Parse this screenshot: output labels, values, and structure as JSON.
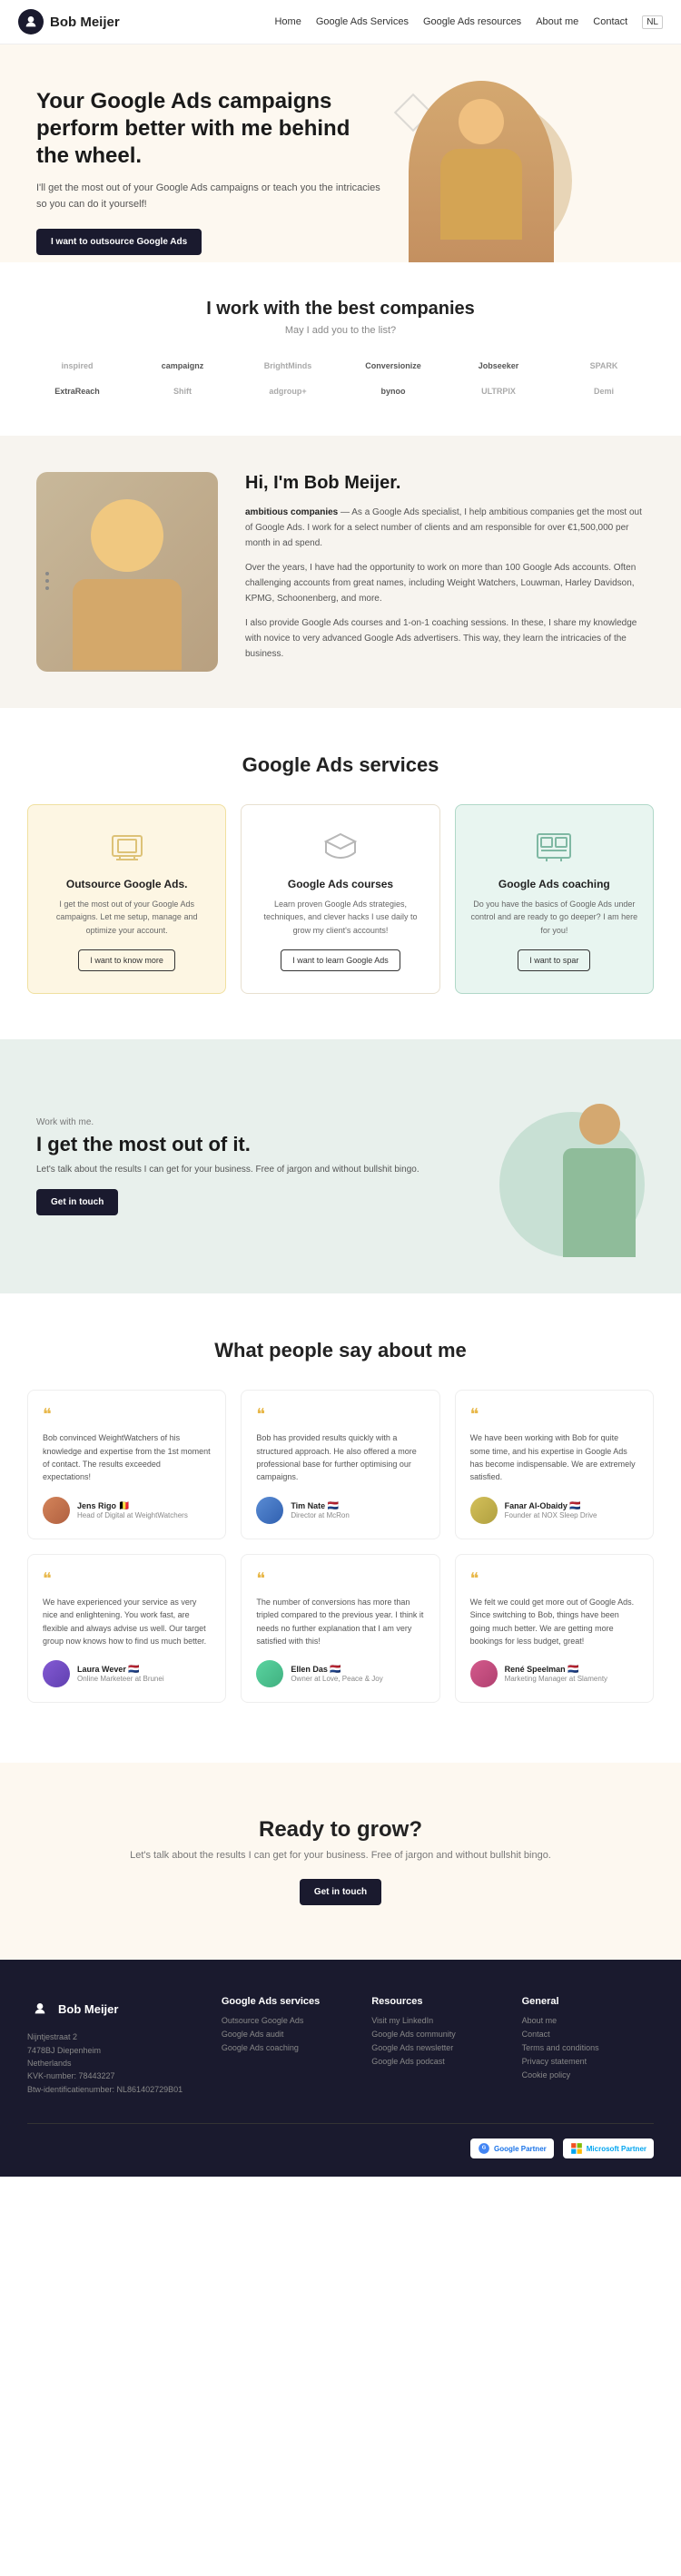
{
  "nav": {
    "brand": "Bob Meijer",
    "links": [
      "Home",
      "Google Ads Services",
      "Google Ads resources",
      "About me",
      "Contact",
      "NL"
    ]
  },
  "hero": {
    "headline": "Your Google Ads campaigns perform better with me behind the wheel.",
    "subtext": "I'll get the most out of your Google Ads campaigns or teach you the intricacies so you can do it yourself!",
    "cta": "I want to outsource Google Ads"
  },
  "companies": {
    "heading": "I work with the best companies",
    "subtext": "May I add you to the list?",
    "logos": [
      "inspired",
      "campaignz",
      "BrightMinds",
      "Conversionize",
      "Jobseeker",
      "SPARK",
      "ExtraReach",
      "Shift",
      "adgroup+",
      "bynoo",
      "ULTRPIX",
      "Demi"
    ]
  },
  "about": {
    "heading": "Hi, I'm Bob Meijer.",
    "paragraphs": [
      "As a Google Ads specialist, I help ambitious companies get the most out of Google Ads. I work for a select number of clients and am responsible for over €1,500,000 per month in ad spend.",
      "Over the years, I have had the opportunity to work on more than 100 Google Ads accounts. Often challenging accounts from great names, including Weight Watchers, Louwman, Harley Davidson, KPMG, Schoonenberg, and more.",
      "I also provide Google Ads courses and 1-on-1 coaching sessions. In these, I share my knowledge with novice to very advanced Google Ads advertisers. This way, they learn the intricacies of the business."
    ]
  },
  "services": {
    "heading": "Google Ads services",
    "cards": [
      {
        "title": "Outsource Google Ads.",
        "description": "I get the most out of your Google Ads campaigns. Let me setup, manage and optimize your account.",
        "cta": "I want to know more",
        "style": "yellow"
      },
      {
        "title": "Google Ads courses",
        "description": "Learn proven Google Ads strategies, techniques, and clever hacks I use daily to grow my client's accounts!",
        "cta": "I want to learn Google Ads",
        "style": "plain"
      },
      {
        "title": "Google Ads coaching",
        "description": "Do you have the basics of Google Ads under control and are ready to go deeper? I am here for you!",
        "cta": "I want to spar",
        "style": "teal"
      }
    ]
  },
  "cta_banner": {
    "label": "Work with me.",
    "heading": "I get the most out of it.",
    "subtext": "Let's talk about the results I can get for your business. Free of jargon and without bullshit bingo.",
    "cta": "Get in touch"
  },
  "testimonials": {
    "heading": "What people say about me",
    "items": [
      {
        "text": "Bob convinced WeightWatchers of his knowledge and expertise from the 1st moment of contact. The results exceeded expectations!",
        "name": "Jens Rigo",
        "flag": "🇧🇪",
        "title": "Head of Digital at WeightWatchers",
        "avatar": "av1"
      },
      {
        "text": "Bob has provided results quickly with a structured approach. He also offered a more professional base for further optimising our campaigns.",
        "name": "Tim Nate",
        "flag": "🇳🇱",
        "title": "Director at McRon",
        "avatar": "av2"
      },
      {
        "text": "We have been working with Bob for quite some time, and his expertise in Google Ads has become indispensable. We are extremely satisfied.",
        "name": "Fanar Al-Obaidy",
        "flag": "🇳🇱",
        "title": "Founder at NOX Sleep Drive",
        "avatar": "av3"
      },
      {
        "text": "We have experienced your service as very nice and enlightening. You work fast, are flexible and always advise us well. Our target group now knows how to find us much better.",
        "name": "Laura Wever",
        "flag": "🇳🇱",
        "title": "Online Marketeer at Brunei",
        "avatar": "av4"
      },
      {
        "text": "The number of conversions has more than tripled compared to the previous year. I think it needs no further explanation that I am very satisfied with this!",
        "name": "Ellen Das",
        "flag": "🇳🇱",
        "title": "Owner at Love, Peace & Joy",
        "avatar": "av5"
      },
      {
        "text": "We felt we could get more out of Google Ads. Since switching to Bob, things have been going much better. We are getting more bookings for less budget, great!",
        "name": "René Speelman",
        "flag": "🇳🇱",
        "title": "Marketing Manager at Slamenty",
        "avatar": "av6"
      }
    ]
  },
  "ready": {
    "heading": "Ready to grow?",
    "subtext": "Let's talk about the results I can get for your business. Free of jargon and without bullshit bingo.",
    "cta": "Get in touch"
  },
  "footer": {
    "brand": "Bob Meijer",
    "address": "Nijntjestraat 2\n7478BJ Diepenheim\nNetherlands",
    "kvk": "KVK-number: 78443227",
    "btw": "Btw-identificatienumber: NL861402729B01",
    "columns": [
      {
        "heading": "Google Ads services",
        "links": [
          "Outsource Google Ads",
          "Google Ads audit",
          "Google Ads coaching"
        ]
      },
      {
        "heading": "Resources",
        "links": [
          "Visit my LinkedIn",
          "Google Ads community",
          "Google Ads newsletter",
          "Google Ads podcast"
        ]
      },
      {
        "heading": "General",
        "links": [
          "About me",
          "Contact",
          "Terms and conditions",
          "Privacy statement",
          "Cookie policy"
        ]
      }
    ],
    "partners": [
      "Google Partner",
      "Microsoft Partner"
    ]
  }
}
